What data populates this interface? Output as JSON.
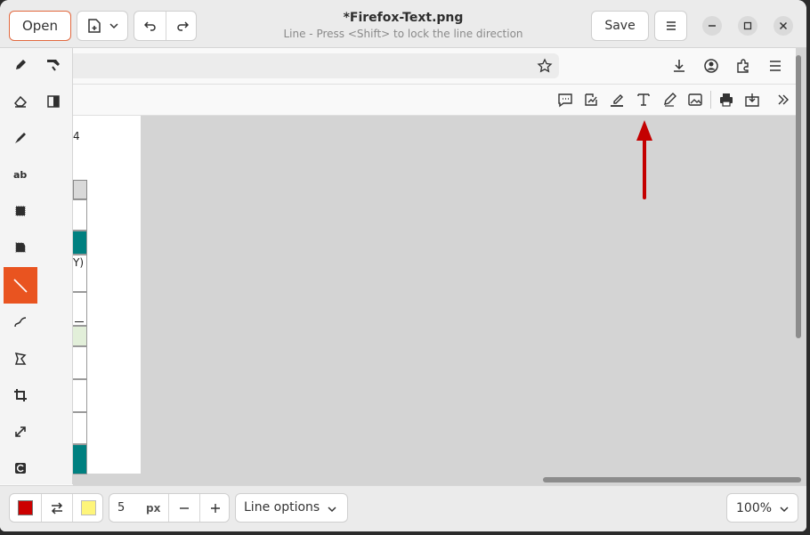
{
  "header": {
    "open_label": "Open",
    "title": "*Firefox-Text.png",
    "subtitle": "Line - Press <Shift> to lock the line direction",
    "save_label": "Save"
  },
  "tools": [
    {
      "name": "pencil-icon"
    },
    {
      "name": "highlighter-icon"
    },
    {
      "name": "eraser-icon"
    },
    {
      "name": "blur-icon"
    },
    {
      "name": "brush-icon"
    },
    {
      "name": "text-tool-icon"
    },
    {
      "name": "rectangle-icon"
    },
    {
      "name": "free-shape-icon"
    },
    {
      "name": "line-icon",
      "active": true
    },
    {
      "name": "curve-icon"
    },
    {
      "name": "polygon-icon"
    },
    {
      "name": "crop-icon"
    },
    {
      "name": "scale-icon"
    },
    {
      "name": "filters-icon"
    }
  ],
  "canvas_image": {
    "partial_text": "4",
    "partial_text_2": "Y)"
  },
  "bottom": {
    "main_color": "#cc0000",
    "secondary_color": "#fef57a",
    "size_value": "5",
    "size_unit": "px",
    "line_options_label": "Line options",
    "zoom_value": "100%"
  },
  "colors": {
    "accent": "#e95420",
    "arrow": "#cc0000",
    "teal": "#008080"
  }
}
